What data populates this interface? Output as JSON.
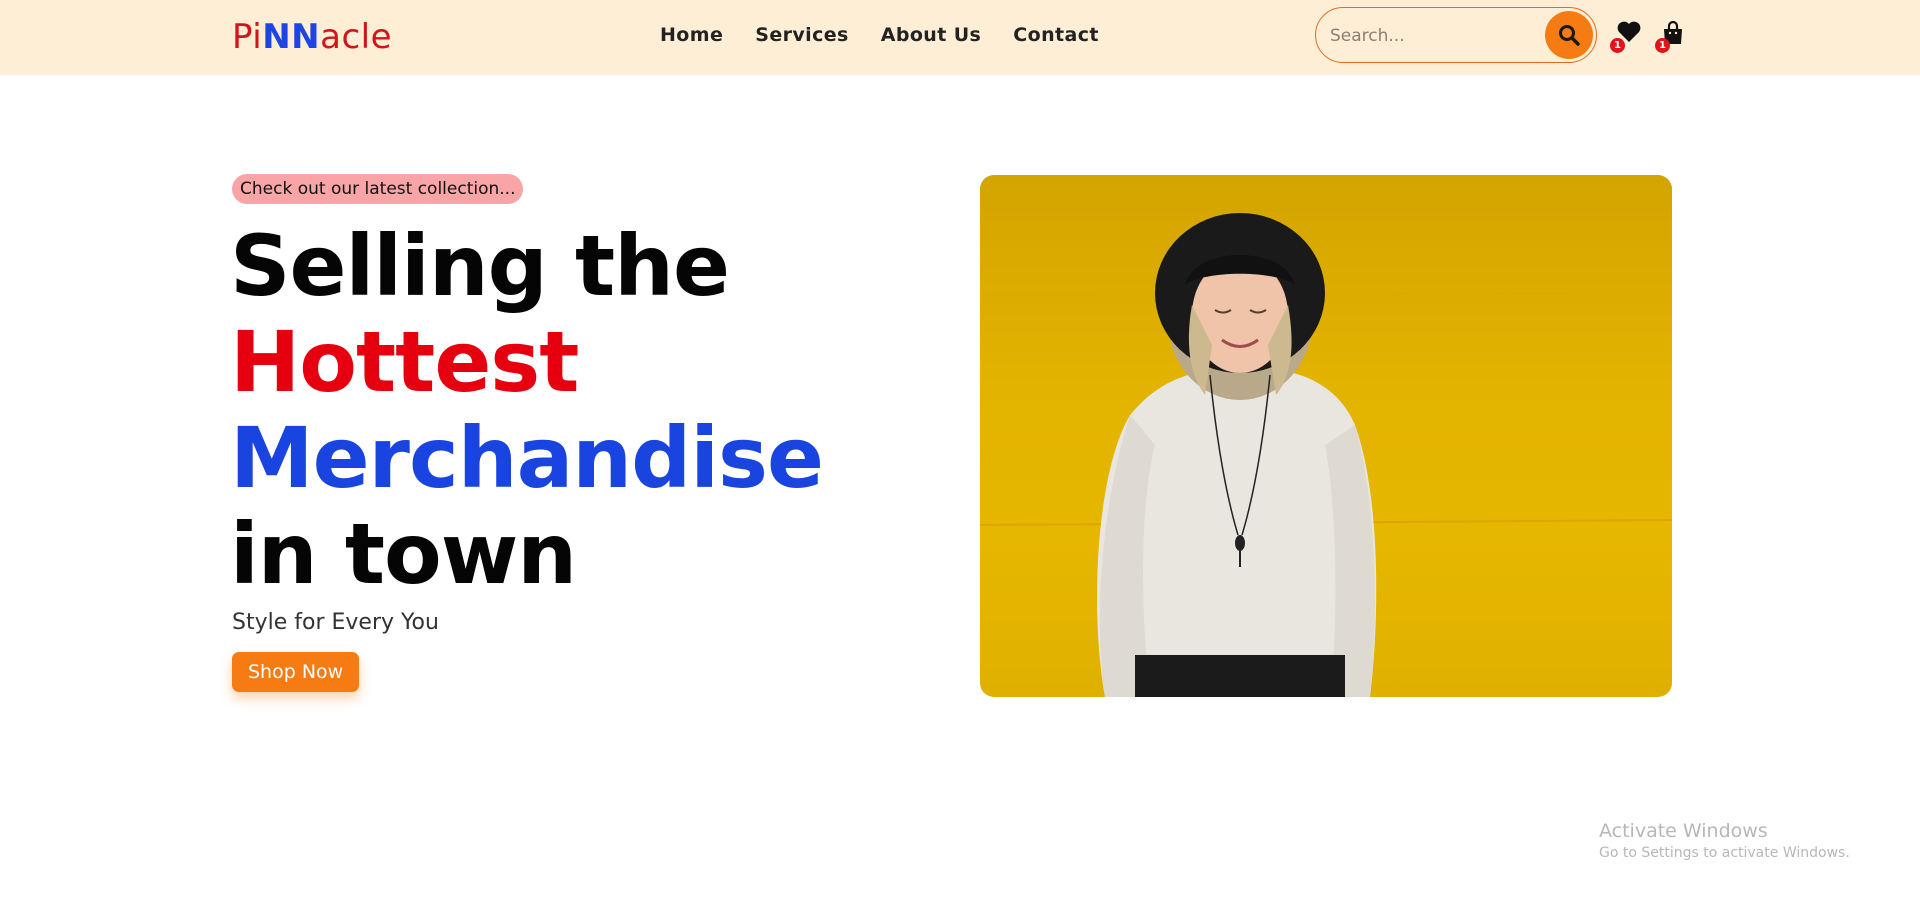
{
  "header": {
    "logo": {
      "part1": "Pi",
      "part2": "NN",
      "part3": "acle"
    },
    "nav": [
      "Home",
      "Services",
      "About Us",
      "Contact"
    ],
    "search": {
      "placeholder": "Search..."
    },
    "wishlist_count": "1",
    "cart_count": "1"
  },
  "hero": {
    "tagline": "Check out our latest collection...",
    "headline": {
      "line1": "Selling the",
      "line2": "Hottest",
      "line3": "Merchandise",
      "line4": "in town"
    },
    "subheading": "Style for Every You",
    "cta": "Shop Now"
  },
  "watermark": {
    "title": "Activate Windows",
    "subtitle": "Go to Settings to activate Windows."
  },
  "colors": {
    "header_bg": "#ffeed6",
    "accent_orange": "#f67b12",
    "brand_red": "#e6000f",
    "brand_blue": "#1a44e0",
    "tag_pink": "#f9a4a6",
    "hero_yellow": "#e2b300"
  },
  "icons": [
    "search-icon",
    "heart-icon",
    "shopping-bag-icon"
  ]
}
